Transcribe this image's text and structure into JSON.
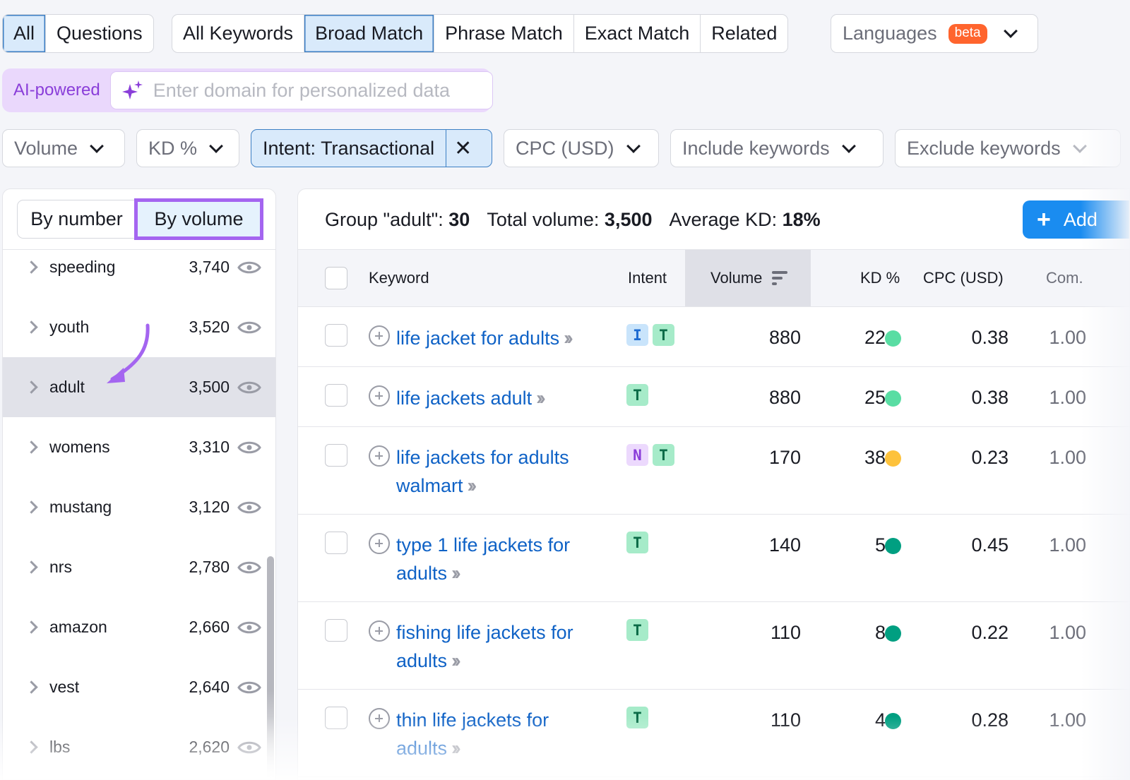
{
  "tabs_scope": {
    "items": [
      {
        "label": "All",
        "active": true
      },
      {
        "label": "Questions",
        "active": false
      }
    ]
  },
  "tabs_match": {
    "items": [
      {
        "label": "All Keywords",
        "active": false
      },
      {
        "label": "Broad Match",
        "active": true
      },
      {
        "label": "Phrase Match",
        "active": false
      },
      {
        "label": "Exact Match",
        "active": false
      },
      {
        "label": "Related",
        "active": false
      }
    ]
  },
  "languages": {
    "label": "Languages",
    "badge": "beta"
  },
  "ai": {
    "label": "AI-powered",
    "placeholder": "Enter domain for personalized data",
    "value": ""
  },
  "filters": {
    "volume": "Volume",
    "kd": "KD %",
    "intent_applied": "Intent: Transactional",
    "intent_clear": "✕",
    "cpc": "CPC (USD)",
    "include": "Include keywords",
    "exclude": "Exclude keywords"
  },
  "groups_panel": {
    "toggle": {
      "by_number": "By number",
      "by_volume": "By volume",
      "selected": "By volume"
    },
    "groups": [
      {
        "name": "speeding",
        "volume": "3,740",
        "selected": false
      },
      {
        "name": "youth",
        "volume": "3,520",
        "selected": false
      },
      {
        "name": "adult",
        "volume": "3,500",
        "selected": true
      },
      {
        "name": "womens",
        "volume": "3,310",
        "selected": false
      },
      {
        "name": "mustang",
        "volume": "3,120",
        "selected": false
      },
      {
        "name": "nrs",
        "volume": "2,780",
        "selected": false
      },
      {
        "name": "amazon",
        "volume": "2,660",
        "selected": false
      },
      {
        "name": "vest",
        "volume": "2,640",
        "selected": false
      },
      {
        "name": "lbs",
        "volume": "2,620",
        "selected": false
      }
    ]
  },
  "summary": {
    "group_label": "Group \"adult\":",
    "group_count": "30",
    "total_label": "Total volume:",
    "total_value": "3,500",
    "kd_label": "Average KD:",
    "kd_value": "18%",
    "add_button": "Add"
  },
  "table": {
    "headers": {
      "keyword": "Keyword",
      "intent": "Intent",
      "volume": "Volume",
      "kd": "KD %",
      "cpc": "CPC (USD)",
      "com": "Com."
    },
    "intent_colors": {
      "I": {
        "bg": "#c9e4fb",
        "fg": "#1c6ad1"
      },
      "T": {
        "bg": "#a6ebc9",
        "fg": "#0b6b47"
      },
      "N": {
        "bg": "#ecd9fd",
        "fg": "#8a3ed9"
      }
    },
    "kd_colors": {
      "easy": "#009f81",
      "possible": "#59dda3",
      "difficult": "#fdc23c"
    },
    "rows": [
      {
        "keyword": "life jacket for adults",
        "intents": [
          "I",
          "T"
        ],
        "volume": "880",
        "kd": "22",
        "kd_level": "possible",
        "cpc": "0.38",
        "com": "1.00"
      },
      {
        "keyword": "life jackets adult",
        "intents": [
          "T"
        ],
        "volume": "880",
        "kd": "25",
        "kd_level": "possible",
        "cpc": "0.38",
        "com": "1.00"
      },
      {
        "keyword": "life jackets for adults walmart",
        "intents": [
          "N",
          "T"
        ],
        "volume": "170",
        "kd": "38",
        "kd_level": "difficult",
        "cpc": "0.23",
        "com": "1.00"
      },
      {
        "keyword": "type 1 life jackets for adults",
        "intents": [
          "T"
        ],
        "volume": "140",
        "kd": "5",
        "kd_level": "easy",
        "cpc": "0.45",
        "com": "1.00"
      },
      {
        "keyword": "fishing life jackets for adults",
        "intents": [
          "T"
        ],
        "volume": "110",
        "kd": "8",
        "kd_level": "easy",
        "cpc": "0.22",
        "com": "1.00"
      },
      {
        "keyword": "thin life jackets for adults",
        "intents": [
          "T"
        ],
        "volume": "110",
        "kd": "4",
        "kd_level": "easy",
        "cpc": "0.28",
        "com": "1.00"
      }
    ]
  }
}
